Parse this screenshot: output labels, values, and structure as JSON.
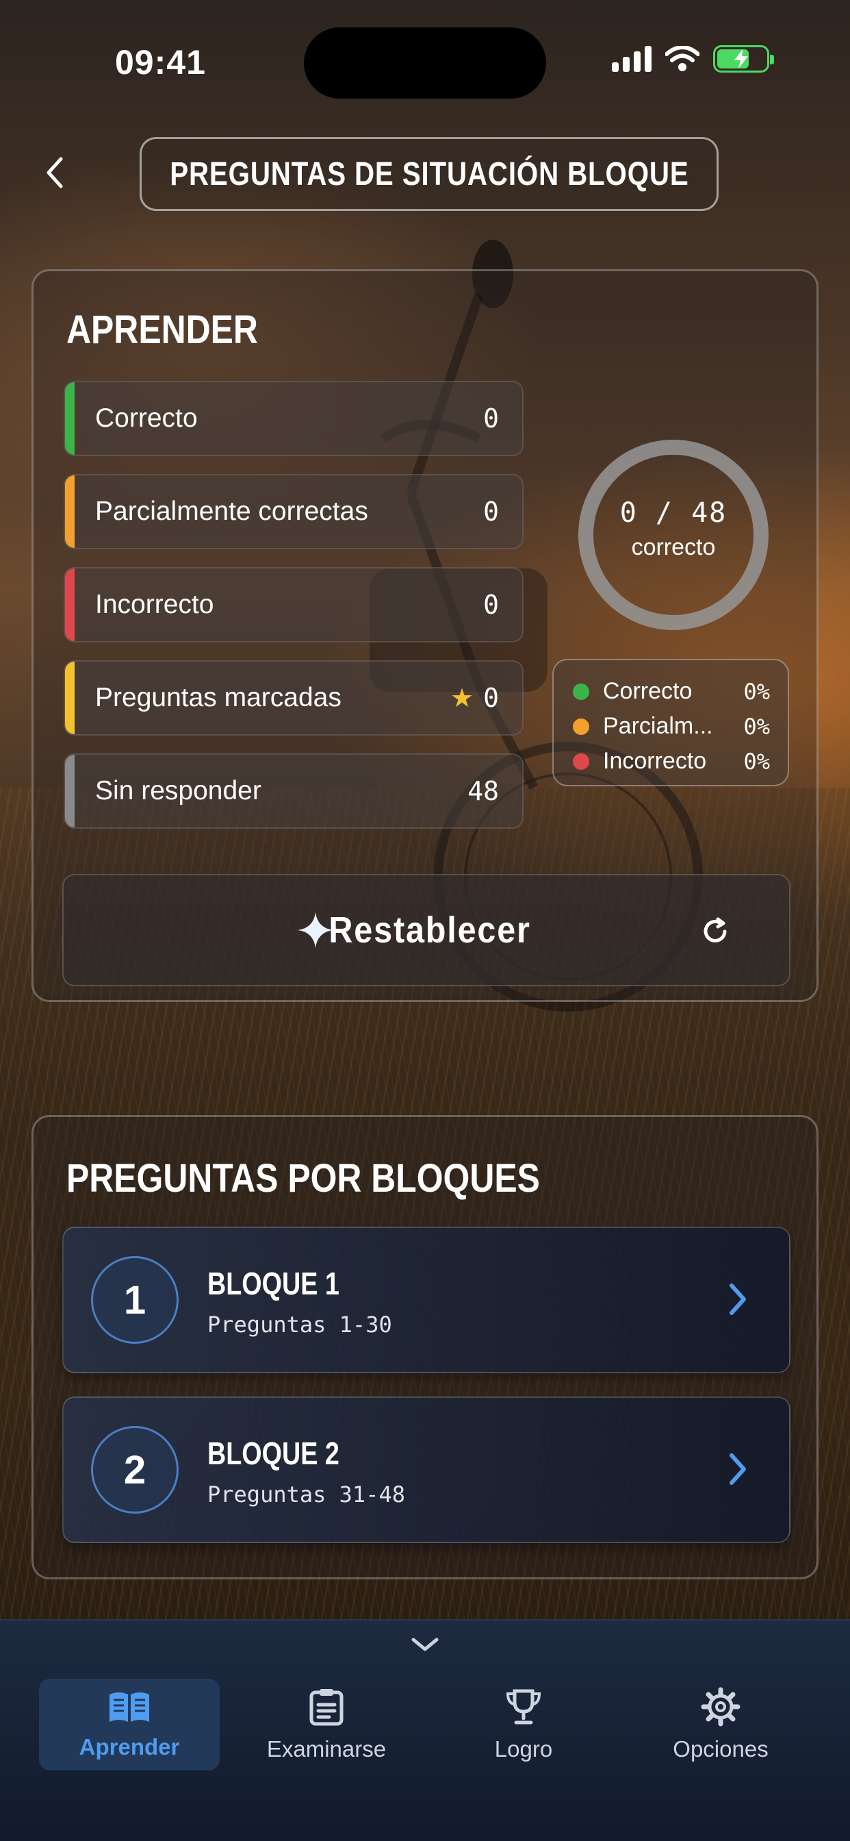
{
  "status_bar": {
    "time": "09:41"
  },
  "header": {
    "title": "PREGUNTAS DE SITUACIÓN BLOQUE"
  },
  "learn": {
    "section_title": "APRENDER",
    "stats": [
      {
        "label": "Correcto",
        "value": "0",
        "color": "#3bb54a"
      },
      {
        "label": "Parcialmente correctas",
        "value": "0",
        "color": "#f2a12e"
      },
      {
        "label": "Incorrecto",
        "value": "0",
        "color": "#e0474c"
      },
      {
        "label": "Preguntas marcadas",
        "value": "0",
        "color": "#f5c22b",
        "icon": "star-icon"
      },
      {
        "label": "Sin responder",
        "value": "48",
        "color": "#8a8a8a"
      }
    ],
    "progress": {
      "count": "0 / 48",
      "label": "correcto",
      "fraction": 0
    },
    "legend": [
      {
        "name": "Correcto",
        "pct": "0%",
        "color": "#3bb54a"
      },
      {
        "name": "Parcialm...",
        "pct": "0%",
        "color": "#f2a12e"
      },
      {
        "name": "Incorrecto",
        "pct": "0%",
        "color": "#e0474c"
      }
    ],
    "reset_label": "Restablecer"
  },
  "blocks": {
    "section_title": "PREGUNTAS POR BLOQUES",
    "items": [
      {
        "number": "1",
        "title": "BLOQUE 1",
        "subtitle": "Preguntas 1-30"
      },
      {
        "number": "2",
        "title": "BLOQUE 2",
        "subtitle": "Preguntas 31-48"
      }
    ]
  },
  "tabs": [
    {
      "label": "Aprender",
      "icon": "book-icon",
      "active": true
    },
    {
      "label": "Examinarse",
      "icon": "clipboard-icon",
      "active": false
    },
    {
      "label": "Logro",
      "icon": "trophy-icon",
      "active": false
    },
    {
      "label": "Opciones",
      "icon": "gear-icon",
      "active": false
    }
  ],
  "colors": {
    "accent": "#4f9cf0",
    "tabbar": "#1d2a40"
  }
}
